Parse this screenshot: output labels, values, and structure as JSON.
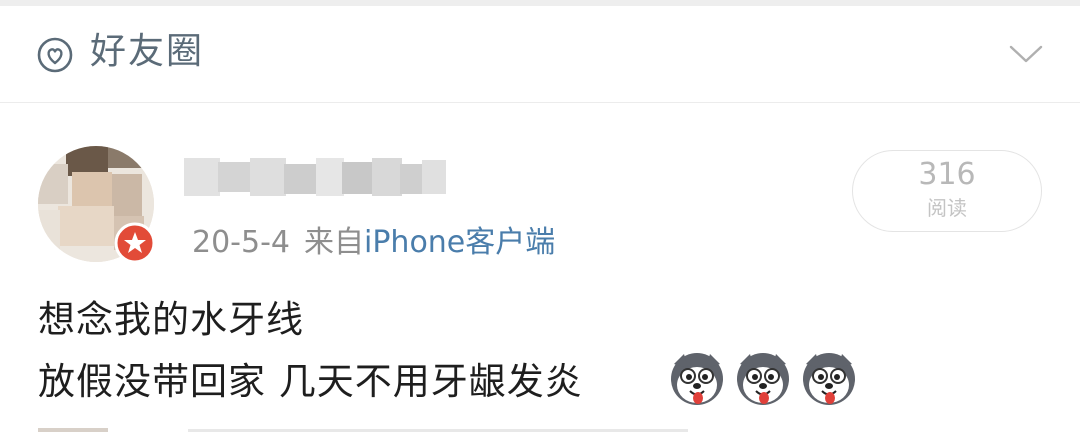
{
  "header": {
    "title": "好友圈",
    "icon": "heart-circle-icon",
    "expand_icon": "chevron-down-icon"
  },
  "post": {
    "date": "20-5-4",
    "from_label": "来自",
    "client": "iPhone客户端",
    "views": {
      "count": "316",
      "label": "阅读"
    },
    "lines": [
      "想念我的水牙线",
      "放假没带回家 几天不用牙龈发炎"
    ],
    "emoji_icon": "husky-dog-emoji-icon",
    "emoji_count": 3
  },
  "colors": {
    "link_blue": "#4a7dab",
    "header_text": "#5b6b78",
    "meta_gray": "#8e8e8e",
    "badge_red": "#e24b38"
  }
}
